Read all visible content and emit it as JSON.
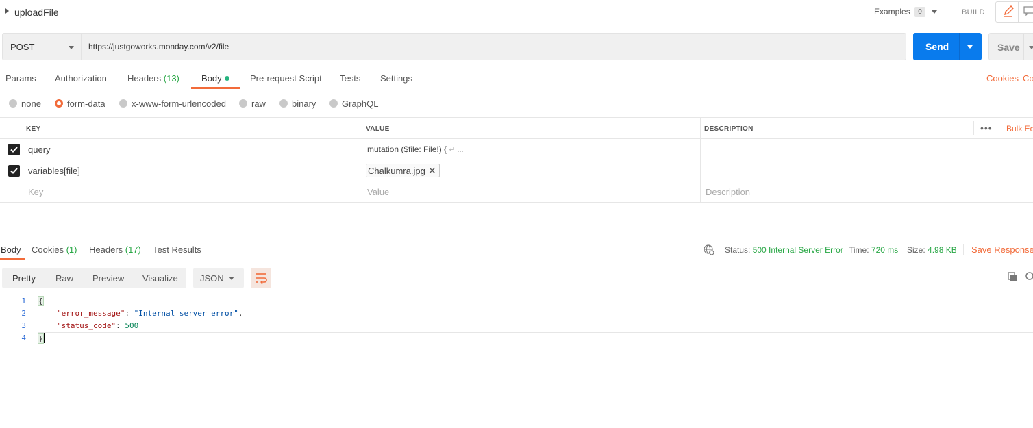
{
  "header": {
    "title": "uploadFile",
    "examples_label": "Examples",
    "examples_count": "0",
    "build_label": "BUILD"
  },
  "request": {
    "method": "POST",
    "url": "https://justgoworks.monday.com/v2/file",
    "send_label": "Send",
    "save_label": "Save"
  },
  "request_tabs": {
    "params": "Params",
    "authorization": "Authorization",
    "headers": "Headers",
    "headers_count": "(13)",
    "body": "Body",
    "pre_request": "Pre-request Script",
    "tests": "Tests",
    "settings": "Settings",
    "cookies": "Cookies",
    "code": "Code"
  },
  "body_types": {
    "none": "none",
    "form_data": "form-data",
    "urlencoded": "x-www-form-urlencoded",
    "raw": "raw",
    "binary": "binary",
    "graphql": "GraphQL",
    "selected": "form-data"
  },
  "params_table": {
    "headers": {
      "key": "KEY",
      "value": "VALUE",
      "description": "DESCRIPTION",
      "bulk_edit": "Bulk Edit"
    },
    "rows": [
      {
        "checked": true,
        "key": "query",
        "value": "mutation ($file: File!) {",
        "value_more": "↵ ..."
      },
      {
        "checked": true,
        "key": "variables[file]",
        "value": "Chalkumra.jpg"
      }
    ],
    "placeholders": {
      "key": "Key",
      "value": "Value",
      "description": "Description"
    }
  },
  "response_tabs": {
    "body": "Body",
    "cookies": "Cookies",
    "cookies_count": "(1)",
    "headers": "Headers",
    "headers_count": "(17)",
    "test_results": "Test Results"
  },
  "response_meta": {
    "status_label": "Status:",
    "status_value": "500 Internal Server Error",
    "time_label": "Time:",
    "time_value": "720 ms",
    "size_label": "Size:",
    "size_value": "4.98 KB",
    "save_response": "Save Response"
  },
  "response_view": {
    "pretty": "Pretty",
    "raw": "Raw",
    "preview": "Preview",
    "visualize": "Visualize",
    "format": "JSON"
  },
  "response_body": {
    "line_numbers": [
      "1",
      "2",
      "3",
      "4"
    ],
    "open_brace": "{",
    "close_brace": "}",
    "error_message_key": "\"error_message\"",
    "error_message_value": "\"Internal server error\"",
    "status_code_key": "\"status_code\"",
    "status_code_value": "500"
  },
  "colors": {
    "accent": "#f26b3a",
    "send_blue": "#097bed",
    "success_green": "#28a745"
  }
}
